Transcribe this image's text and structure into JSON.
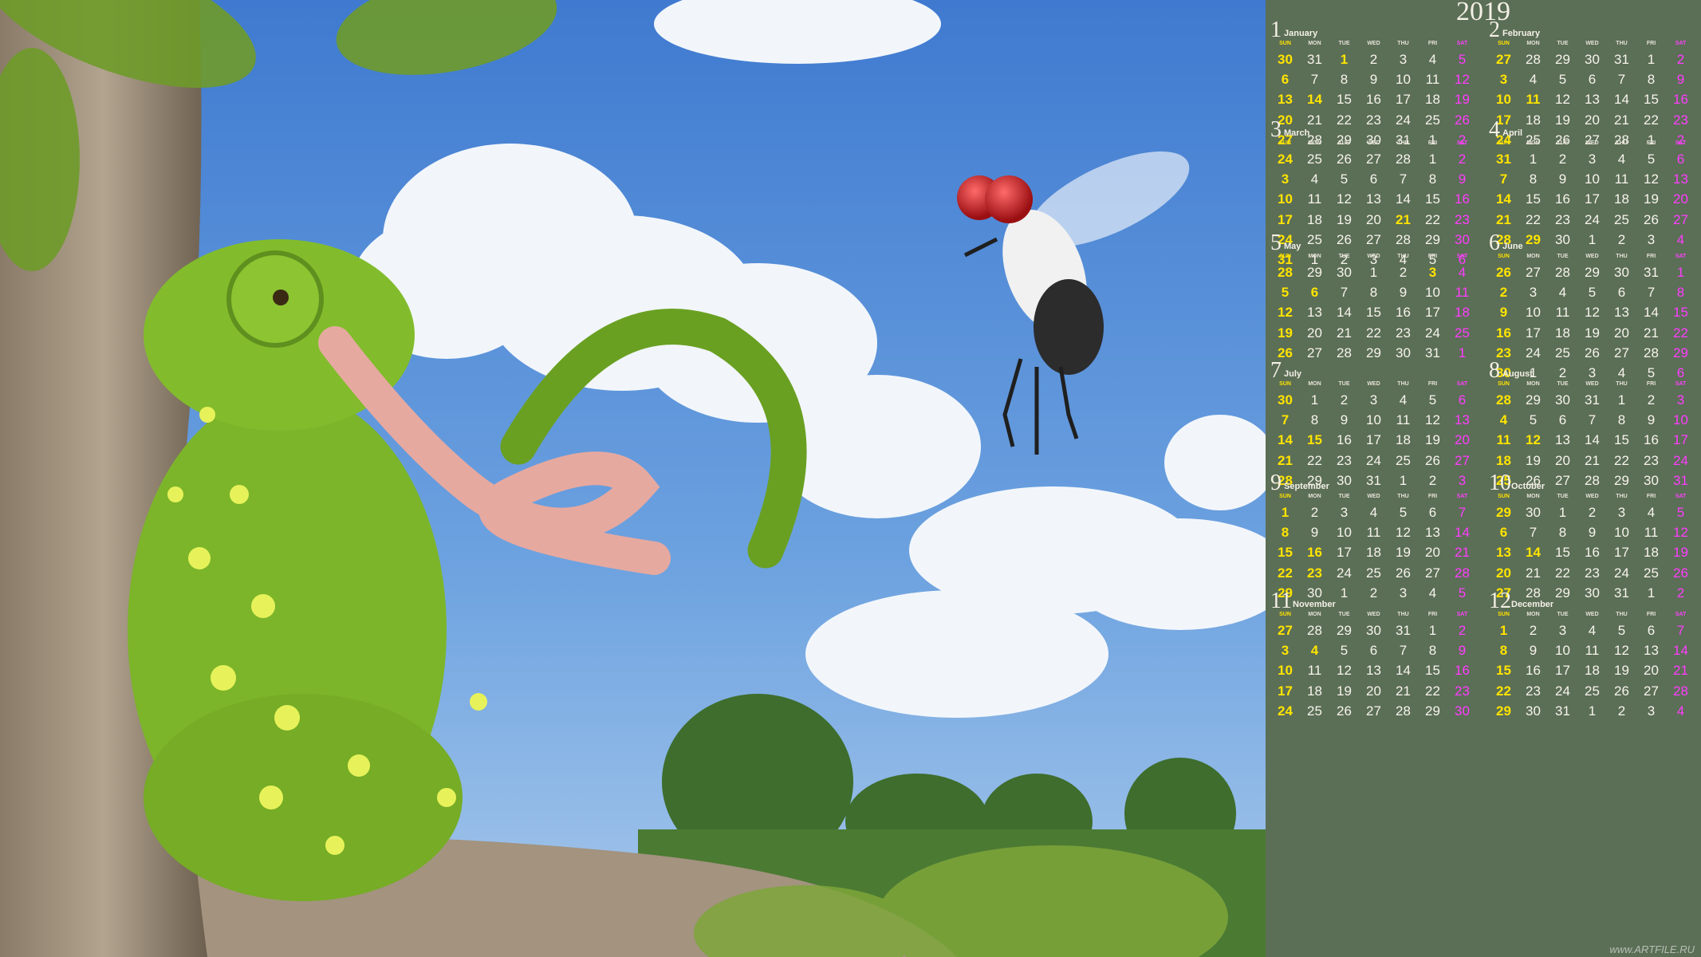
{
  "year": "2019",
  "watermark": "www.ARTFILE.RU",
  "day_headers": [
    "SUN",
    "MON",
    "TUE",
    "WED",
    "THU",
    "FRI",
    "SAT"
  ],
  "colors": {
    "calendar_bg": "#5b6e56",
    "sunday": "#ffe400",
    "saturday": "#ff3cff",
    "text": "#f7f4ec",
    "sky": "#4f86d4"
  },
  "months": [
    {
      "num": "1",
      "name": "January",
      "weeks": [
        [
          "30",
          "31",
          "1",
          "2",
          "3",
          "4",
          "5"
        ],
        [
          "6",
          "7",
          "8",
          "9",
          "10",
          "11",
          "12"
        ],
        [
          "13",
          "14",
          "15",
          "16",
          "17",
          "18",
          "19"
        ],
        [
          "20",
          "21",
          "22",
          "23",
          "24",
          "25",
          "26"
        ],
        [
          "27",
          "28",
          "29",
          "30",
          "31",
          "1",
          "2"
        ]
      ],
      "holidays": [
        "1",
        "14"
      ]
    },
    {
      "num": "2",
      "name": "February",
      "weeks": [
        [
          "27",
          "28",
          "29",
          "30",
          "31",
          "1",
          "2"
        ],
        [
          "3",
          "4",
          "5",
          "6",
          "7",
          "8",
          "9"
        ],
        [
          "10",
          "11",
          "12",
          "13",
          "14",
          "15",
          "16"
        ],
        [
          "17",
          "18",
          "19",
          "20",
          "21",
          "22",
          "23"
        ],
        [
          "24",
          "25",
          "26",
          "27",
          "28",
          "1",
          "2"
        ]
      ],
      "holidays": [
        "11"
      ]
    },
    {
      "num": "3",
      "name": "March",
      "weeks": [
        [
          "24",
          "25",
          "26",
          "27",
          "28",
          "1",
          "2"
        ],
        [
          "3",
          "4",
          "5",
          "6",
          "7",
          "8",
          "9"
        ],
        [
          "10",
          "11",
          "12",
          "13",
          "14",
          "15",
          "16"
        ],
        [
          "17",
          "18",
          "19",
          "20",
          "21",
          "22",
          "23"
        ],
        [
          "24",
          "25",
          "26",
          "27",
          "28",
          "29",
          "30"
        ],
        [
          "31",
          "1",
          "2",
          "3",
          "4",
          "5",
          "6"
        ]
      ],
      "holidays": [
        "21"
      ]
    },
    {
      "num": "4",
      "name": "April",
      "weeks": [
        [
          "31",
          "1",
          "2",
          "3",
          "4",
          "5",
          "6"
        ],
        [
          "7",
          "8",
          "9",
          "10",
          "11",
          "12",
          "13"
        ],
        [
          "14",
          "15",
          "16",
          "17",
          "18",
          "19",
          "20"
        ],
        [
          "21",
          "22",
          "23",
          "24",
          "25",
          "26",
          "27"
        ],
        [
          "28",
          "29",
          "30",
          "1",
          "2",
          "3",
          "4"
        ]
      ],
      "holidays": [
        "29"
      ]
    },
    {
      "num": "5",
      "name": "May",
      "weeks": [
        [
          "28",
          "29",
          "30",
          "1",
          "2",
          "3",
          "4"
        ],
        [
          "5",
          "6",
          "7",
          "8",
          "9",
          "10",
          "11"
        ],
        [
          "12",
          "13",
          "14",
          "15",
          "16",
          "17",
          "18"
        ],
        [
          "19",
          "20",
          "21",
          "22",
          "23",
          "24",
          "25"
        ],
        [
          "26",
          "27",
          "28",
          "29",
          "30",
          "31",
          "1"
        ]
      ],
      "holidays": [
        "3",
        "6"
      ]
    },
    {
      "num": "6",
      "name": "June",
      "weeks": [
        [
          "26",
          "27",
          "28",
          "29",
          "30",
          "31",
          "1"
        ],
        [
          "2",
          "3",
          "4",
          "5",
          "6",
          "7",
          "8"
        ],
        [
          "9",
          "10",
          "11",
          "12",
          "13",
          "14",
          "15"
        ],
        [
          "16",
          "17",
          "18",
          "19",
          "20",
          "21",
          "22"
        ],
        [
          "23",
          "24",
          "25",
          "26",
          "27",
          "28",
          "29"
        ],
        [
          "30",
          "1",
          "2",
          "3",
          "4",
          "5",
          "6"
        ]
      ],
      "holidays": []
    },
    {
      "num": "7",
      "name": "July",
      "weeks": [
        [
          "30",
          "1",
          "2",
          "3",
          "4",
          "5",
          "6"
        ],
        [
          "7",
          "8",
          "9",
          "10",
          "11",
          "12",
          "13"
        ],
        [
          "14",
          "15",
          "16",
          "17",
          "18",
          "19",
          "20"
        ],
        [
          "21",
          "22",
          "23",
          "24",
          "25",
          "26",
          "27"
        ],
        [
          "28",
          "29",
          "30",
          "31",
          "1",
          "2",
          "3"
        ]
      ],
      "holidays": [
        "15"
      ]
    },
    {
      "num": "8",
      "name": "August",
      "weeks": [
        [
          "28",
          "29",
          "30",
          "31",
          "1",
          "2",
          "3"
        ],
        [
          "4",
          "5",
          "6",
          "7",
          "8",
          "9",
          "10"
        ],
        [
          "11",
          "12",
          "13",
          "14",
          "15",
          "16",
          "17"
        ],
        [
          "18",
          "19",
          "20",
          "21",
          "22",
          "23",
          "24"
        ],
        [
          "25",
          "26",
          "27",
          "28",
          "29",
          "30",
          "31"
        ]
      ],
      "holidays": [
        "12"
      ]
    },
    {
      "num": "9",
      "name": "September",
      "weeks": [
        [
          "1",
          "2",
          "3",
          "4",
          "5",
          "6",
          "7"
        ],
        [
          "8",
          "9",
          "10",
          "11",
          "12",
          "13",
          "14"
        ],
        [
          "15",
          "16",
          "17",
          "18",
          "19",
          "20",
          "21"
        ],
        [
          "22",
          "23",
          "24",
          "25",
          "26",
          "27",
          "28"
        ],
        [
          "29",
          "30",
          "1",
          "2",
          "3",
          "4",
          "5"
        ]
      ],
      "holidays": [
        "16",
        "23"
      ]
    },
    {
      "num": "10",
      "name": "October",
      "weeks": [
        [
          "29",
          "30",
          "1",
          "2",
          "3",
          "4",
          "5"
        ],
        [
          "6",
          "7",
          "8",
          "9",
          "10",
          "11",
          "12"
        ],
        [
          "13",
          "14",
          "15",
          "16",
          "17",
          "18",
          "19"
        ],
        [
          "20",
          "21",
          "22",
          "23",
          "24",
          "25",
          "26"
        ],
        [
          "27",
          "28",
          "29",
          "30",
          "31",
          "1",
          "2"
        ]
      ],
      "holidays": [
        "14"
      ]
    },
    {
      "num": "11",
      "name": "November",
      "weeks": [
        [
          "27",
          "28",
          "29",
          "30",
          "31",
          "1",
          "2"
        ],
        [
          "3",
          "4",
          "5",
          "6",
          "7",
          "8",
          "9"
        ],
        [
          "10",
          "11",
          "12",
          "13",
          "14",
          "15",
          "16"
        ],
        [
          "17",
          "18",
          "19",
          "20",
          "21",
          "22",
          "23"
        ],
        [
          "24",
          "25",
          "26",
          "27",
          "28",
          "29",
          "30"
        ]
      ],
      "holidays": [
        "4"
      ]
    },
    {
      "num": "12",
      "name": "December",
      "weeks": [
        [
          "1",
          "2",
          "3",
          "4",
          "5",
          "6",
          "7"
        ],
        [
          "8",
          "9",
          "10",
          "11",
          "12",
          "13",
          "14"
        ],
        [
          "15",
          "16",
          "17",
          "18",
          "19",
          "20",
          "21"
        ],
        [
          "22",
          "23",
          "24",
          "25",
          "26",
          "27",
          "28"
        ],
        [
          "29",
          "30",
          "31",
          "1",
          "2",
          "3",
          "4"
        ]
      ],
      "holidays": []
    }
  ]
}
